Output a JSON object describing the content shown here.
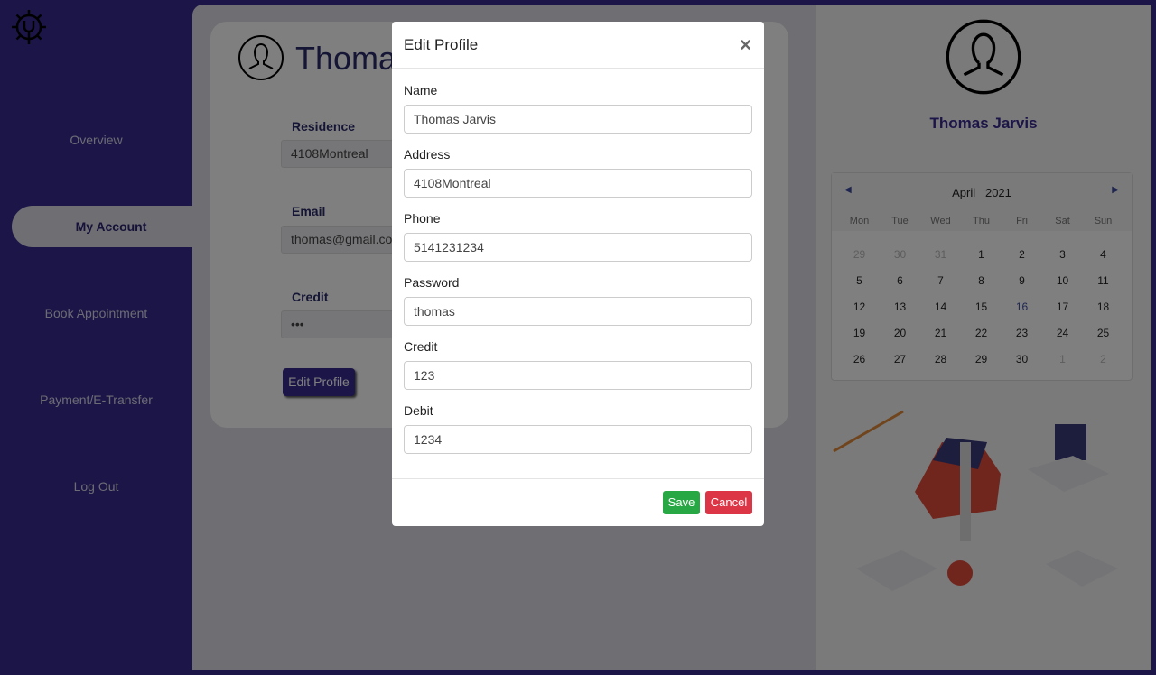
{
  "sidebar": {
    "items": [
      {
        "label": "Overview"
      },
      {
        "label": "My Account"
      },
      {
        "label": "Book Appointment"
      },
      {
        "label": "Payment/E-Transfer"
      },
      {
        "label": "Log Out"
      }
    ],
    "active": "My Account"
  },
  "profile_card": {
    "name": "Thomas",
    "fields": [
      {
        "label": "Residence",
        "value": "4108Montreal"
      },
      {
        "label": "Email",
        "value": "thomas@gmail.com"
      },
      {
        "label": "Credit",
        "value": "•••"
      }
    ],
    "edit_label": "Edit Profile"
  },
  "right_panel": {
    "name": "Thomas Jarvis",
    "calendar": {
      "month": "April",
      "year": "2021",
      "weekdays": [
        "Mon",
        "Tue",
        "Wed",
        "Thu",
        "Fri",
        "Sat",
        "Sun"
      ],
      "days": [
        "29",
        "30",
        "31",
        "1",
        "2",
        "3",
        "4",
        "5",
        "6",
        "7",
        "8",
        "9",
        "10",
        "11",
        "12",
        "13",
        "14",
        "15",
        "16",
        "17",
        "18",
        "19",
        "20",
        "21",
        "22",
        "23",
        "24",
        "25",
        "26",
        "27",
        "28",
        "29",
        "30",
        "1",
        "2"
      ],
      "today": "16"
    }
  },
  "modal": {
    "title": "Edit Profile",
    "close": "×",
    "fields": [
      {
        "label": "Name",
        "value": "Thomas Jarvis"
      },
      {
        "label": "Address",
        "value": "4108Montreal"
      },
      {
        "label": "Phone",
        "value": "5141231234"
      },
      {
        "label": "Password",
        "value": "thomas"
      },
      {
        "label": "Credit",
        "value": "123"
      },
      {
        "label": "Debit",
        "value": "1234"
      }
    ],
    "save": "Save",
    "cancel": "Cancel"
  },
  "colors": {
    "brand": "#382a90",
    "save": "#28a745",
    "cancel": "#dc3545"
  }
}
